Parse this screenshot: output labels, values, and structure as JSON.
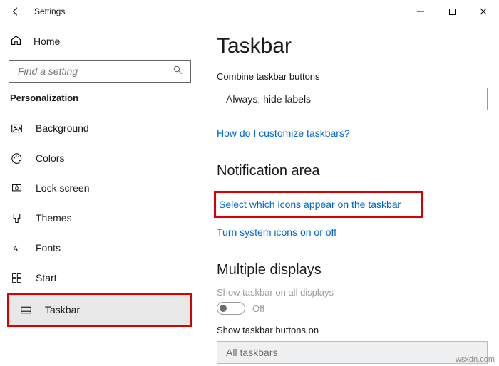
{
  "titlebar": {
    "title": "Settings"
  },
  "sidebar": {
    "home": "Home",
    "search_placeholder": "Find a setting",
    "section": "Personalization",
    "items": [
      {
        "label": "Background"
      },
      {
        "label": "Colors"
      },
      {
        "label": "Lock screen"
      },
      {
        "label": "Themes"
      },
      {
        "label": "Fonts"
      },
      {
        "label": "Start"
      },
      {
        "label": "Taskbar"
      }
    ]
  },
  "content": {
    "title": "Taskbar",
    "combine_label": "Combine taskbar buttons",
    "combine_value": "Always, hide labels",
    "customize_link": "How do I customize taskbars?",
    "notification_heading": "Notification area",
    "select_icons_link": "Select which icons appear on the taskbar",
    "system_icons_link": "Turn system icons on or off",
    "multi_heading": "Multiple displays",
    "show_all_label": "Show taskbar on all displays",
    "toggle_state": "Off",
    "show_buttons_label": "Show taskbar buttons on",
    "show_buttons_value": "All taskbars"
  },
  "watermark": "wsxdn.com"
}
